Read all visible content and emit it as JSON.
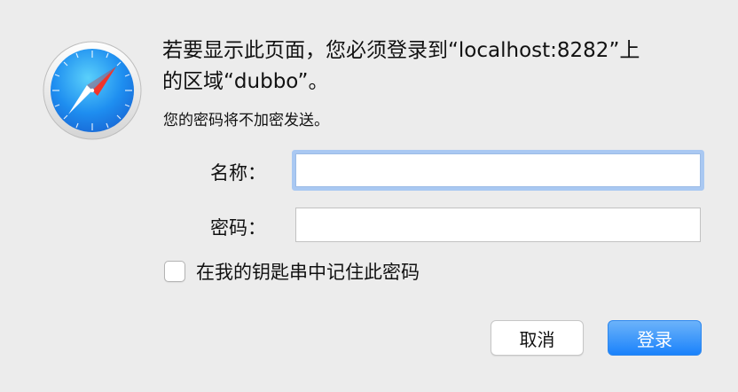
{
  "dialog": {
    "app_icon": "safari-compass-icon",
    "message_line1": "若要显示此页面，您必须登录到“localhost:8282”上",
    "message_line2": "的区域“dubbo”。",
    "info": "您的密码将不加密发送。",
    "name_label": "名称：",
    "name_value": "",
    "password_label": "密码：",
    "password_value": "",
    "remember_checked": false,
    "remember_label": "在我的钥匙串中记住此密码",
    "cancel_label": "取消",
    "login_label": "登录"
  },
  "colors": {
    "background": "#ececec",
    "focus_ring": "#a9c8f2",
    "primary_button": "#1a82fb"
  }
}
